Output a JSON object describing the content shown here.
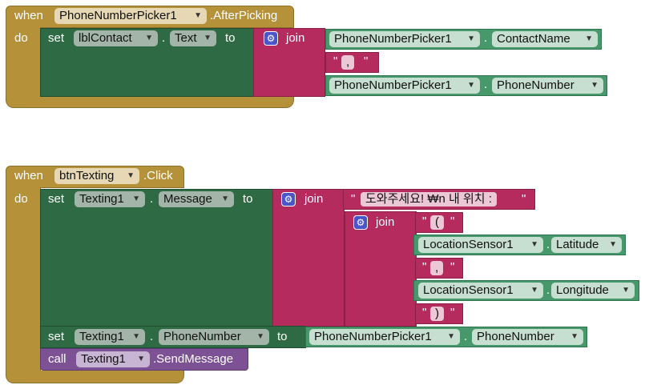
{
  "colors": {
    "event": "#b5913a",
    "set": "#2e6b45",
    "text": "#b52b5e",
    "component": "#47996b",
    "procedure": "#7d5295"
  },
  "block1": {
    "when": "when",
    "do": "do",
    "component": "PhoneNumberPicker1",
    "event": ".AfterPicking",
    "set_kw": "set",
    "set_component": "lblContact",
    "dot": ".",
    "set_property": "Text",
    "to": "to",
    "join": "join",
    "join_icon": "gear-icon",
    "arg1_component": "PhoneNumberPicker1",
    "arg1_property": "ContactName",
    "arg2_string": ", ",
    "arg3_component": "PhoneNumberPicker1",
    "arg3_property": "PhoneNumber"
  },
  "block2": {
    "when": "when",
    "do": "do",
    "component": "btnTexting",
    "event": ".Click",
    "set1_kw": "set",
    "set1_component": "Texting1",
    "set1_property": "Message",
    "to": "to",
    "join": "join",
    "dot": ".",
    "string1": "도와주세요! ₩n 내 위치 : ",
    "inner_join": "join",
    "inner_string1": "(",
    "lat_component": "LocationSensor1",
    "lat_property": "Latitude",
    "inner_string2": ", ",
    "lon_component": "LocationSensor1",
    "lon_property": "Longitude",
    "inner_string3": ")",
    "set2_kw": "set",
    "set2_component": "Texting1",
    "set2_property": "PhoneNumber",
    "set2_value_component": "PhoneNumberPicker1",
    "set2_value_property": "PhoneNumber",
    "call_kw": "call",
    "call_component": "Texting1",
    "call_method": ".SendMessage"
  }
}
